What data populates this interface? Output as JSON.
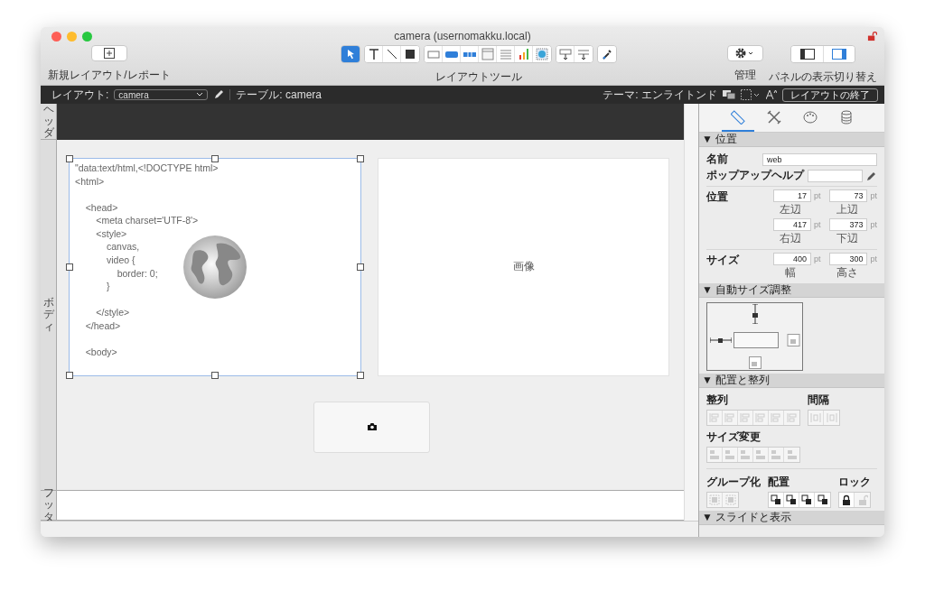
{
  "window": {
    "title": "camera (usernomakku.local)",
    "locked": false
  },
  "toolbar": {
    "new_layout_label": "新規レイアウト/レポート",
    "tools_label": "レイアウトツール",
    "tool_groups": [
      [
        {
          "kind": "pointer",
          "selected": true
        }
      ],
      [
        {
          "kind": "text",
          "selected": false
        },
        {
          "kind": "line",
          "selected": false
        },
        {
          "kind": "shape",
          "selected": false
        }
      ],
      [
        {
          "kind": "field",
          "selected": false
        },
        {
          "kind": "button",
          "selected": false
        },
        {
          "kind": "buttonbar",
          "selected": false
        },
        {
          "kind": "popover",
          "selected": false
        },
        {
          "kind": "portal",
          "selected": false
        },
        {
          "kind": "chart",
          "selected": false
        },
        {
          "kind": "webviewer",
          "selected": false
        }
      ],
      [
        {
          "kind": "insertfield",
          "selected": false
        },
        {
          "kind": "insertpart",
          "selected": false
        }
      ],
      [
        {
          "kind": "eyedropper",
          "selected": false
        }
      ]
    ],
    "manage_label": "管理",
    "panels_label": "パネルの表示切り替え",
    "panel_toggles": [
      {
        "selected": false
      },
      {
        "selected": true
      }
    ]
  },
  "layout_bar": {
    "layout_label": "レイアウト:",
    "layout_value": "camera",
    "table": "テーブル: camera",
    "theme": "テーマ: エンライトンド",
    "exit_button": "レイアウトの終了"
  },
  "parts": {
    "header": "ヘッダ",
    "body": "ボディ",
    "footer": "フッタ"
  },
  "canvas": {
    "web_viewer_code": [
      [
        "\"data:text/html,<!DOCTYPE html>",
        "<html>"
      ],
      [
        "    <head>",
        "        <meta charset='UTF-8'>",
        "        <style>",
        "            canvas,",
        "            video {",
        "                border: 0;",
        "            }"
      ],
      [
        "        </style>",
        "    </head>"
      ],
      [
        "    <body>"
      ]
    ],
    "image_label": "画像"
  },
  "inspector": {
    "tabs": [
      {
        "kind": "position",
        "selected": true
      },
      {
        "kind": "style",
        "selected": false
      },
      {
        "kind": "appearance",
        "selected": false
      },
      {
        "kind": "data",
        "selected": false
      }
    ],
    "position_section": {
      "title": "▼ 位置",
      "name_label": "名前",
      "name_value": "web",
      "tooltip_label": "ポップアップヘルプ",
      "position_label": "位置",
      "position_fields": [
        {
          "value": "17",
          "unit": "pt",
          "caption": "左辺"
        },
        {
          "value": "73",
          "unit": "pt",
          "caption": "上辺"
        },
        {
          "value": "417",
          "unit": "pt",
          "caption": "右辺"
        },
        {
          "value": "373",
          "unit": "pt",
          "caption": "下辺"
        }
      ],
      "size_label": "サイズ",
      "size_fields": [
        {
          "value": "400",
          "unit": "pt",
          "caption": "幅"
        },
        {
          "value": "300",
          "unit": "pt",
          "caption": "高さ"
        }
      ]
    },
    "autosize_section": {
      "title": "▼ 自動サイズ調整",
      "anchors": {
        "top": {
          "locked": true
        },
        "left": {
          "locked": true
        },
        "right": {
          "locked": false
        },
        "bottom": {
          "locked": false
        }
      }
    },
    "arrange_section": {
      "title": "▼ 配置と整列",
      "align_label": "整列",
      "spacing_label": "間隔",
      "resize_label": "サイズ変更",
      "group_label": "グループ化",
      "arrange_label": "配置",
      "lock_label": "ロック",
      "align_buttons": [
        {
          "disabled": true
        },
        {
          "disabled": true
        },
        {
          "disabled": true
        },
        {
          "disabled": true
        },
        {
          "disabled": true
        },
        {
          "disabled": true
        }
      ],
      "spacing_buttons": [
        {
          "disabled": true
        },
        {
          "disabled": true
        }
      ],
      "resize_buttons": [
        {
          "disabled": true
        },
        {
          "disabled": true
        },
        {
          "disabled": true
        },
        {
          "disabled": true
        },
        {
          "disabled": true
        },
        {
          "disabled": true
        }
      ],
      "group_buttons": [
        {
          "disabled": true
        },
        {
          "disabled": true
        }
      ],
      "arrange_buttons": [
        {
          "disabled": false
        },
        {
          "disabled": false
        },
        {
          "disabled": false
        },
        {
          "disabled": false
        }
      ],
      "lock_buttons": [
        {
          "kind": "lock",
          "disabled": false
        },
        {
          "kind": "unlock",
          "disabled": true
        }
      ]
    },
    "slide_section": {
      "title": "▼ スライドと表示"
    }
  }
}
